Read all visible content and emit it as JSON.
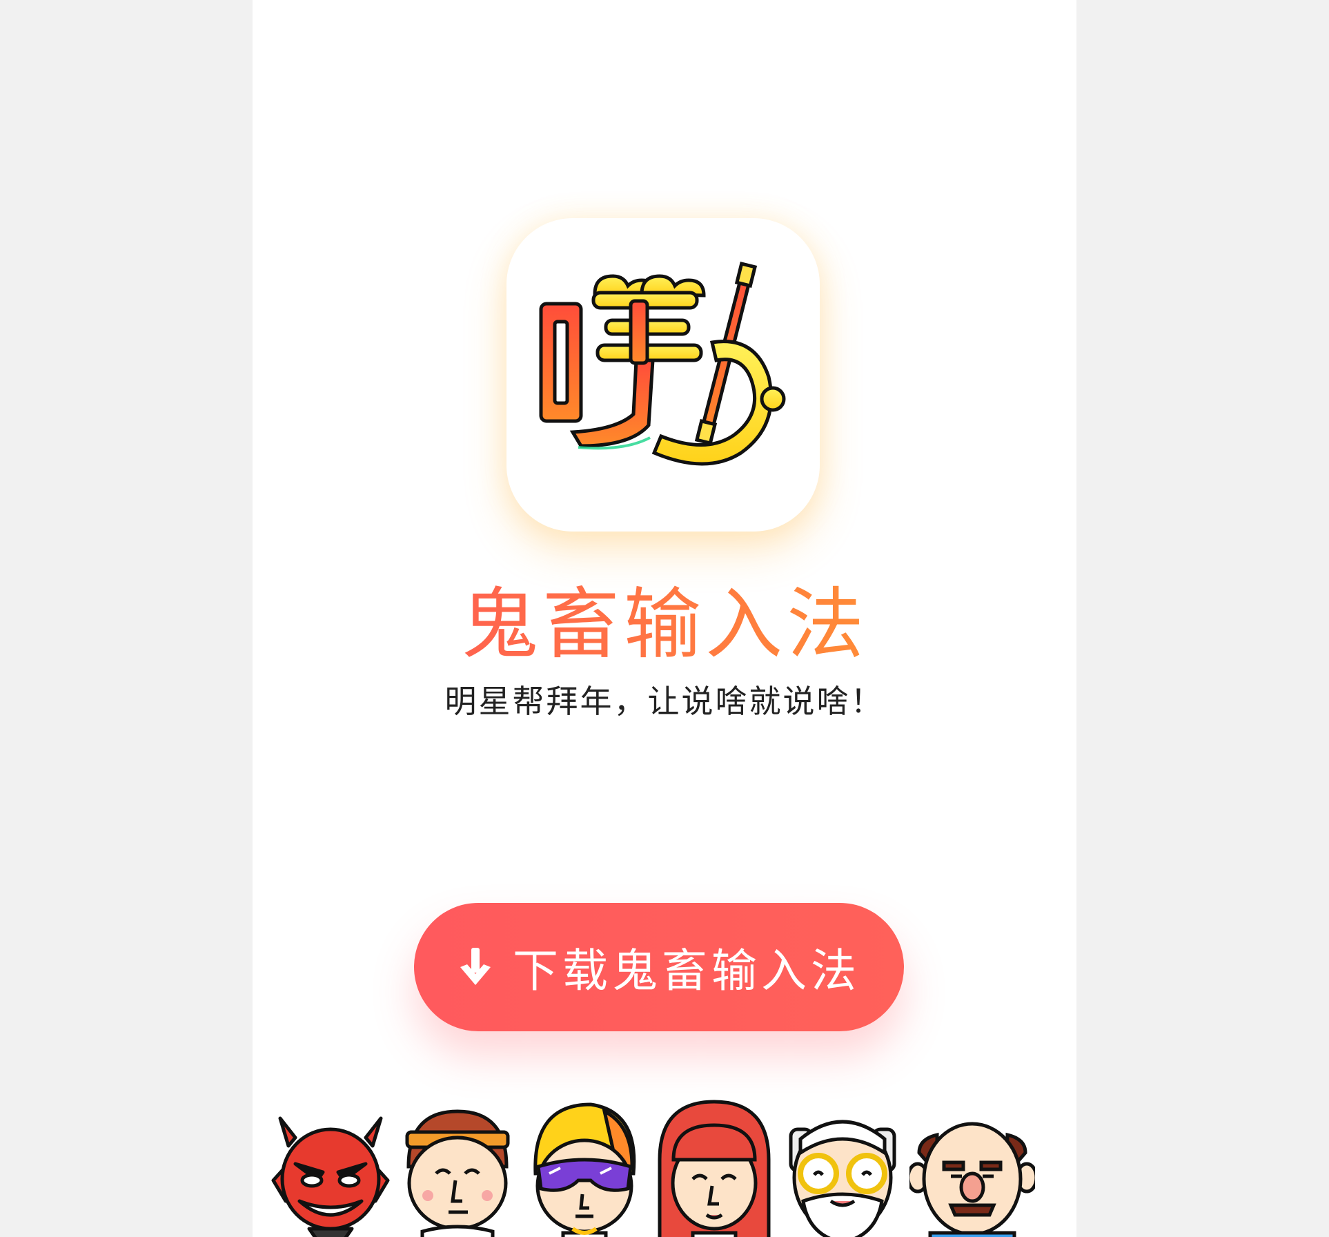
{
  "app": {
    "title": "鬼畜输入法",
    "tagline": "明星帮拜年，让说啥就说啥！"
  },
  "download": {
    "label": "下载鬼畜输入法",
    "icon": "download-arrow-icon"
  },
  "icon": {
    "name": "app-logo-icon",
    "logo_glyph": "噗"
  },
  "characters": [
    {
      "name": "devil-character",
      "icon": "devil-face-icon"
    },
    {
      "name": "headband-character",
      "icon": "headband-face-icon"
    },
    {
      "name": "sunglasses-character",
      "icon": "sunglasses-face-icon"
    },
    {
      "name": "redhair-character",
      "icon": "girl-face-icon"
    },
    {
      "name": "oldman-glasses-character",
      "icon": "old-man-face-icon"
    },
    {
      "name": "mustache-character",
      "icon": "mustache-face-icon"
    }
  ],
  "colors": {
    "button": "#ff5a5d",
    "title_start": "#ff4f5a",
    "title_end": "#ffa12b",
    "background": "#f1f1f1",
    "page": "#ffffff"
  }
}
